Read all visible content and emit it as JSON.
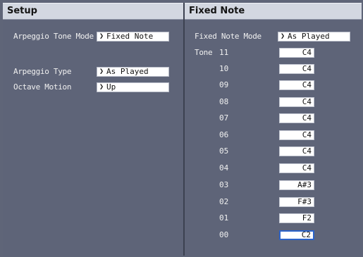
{
  "setup": {
    "title": "Setup",
    "arp_tone_mode_label": "Arpeggio Tone Mode",
    "arp_tone_mode_value": "Fixed Note",
    "arp_type_label": "Arpeggio Type",
    "arp_type_value": "As Played",
    "octave_motion_label": "Octave Motion",
    "octave_motion_value": "Up"
  },
  "fixed": {
    "title": "Fixed Note",
    "mode_label": "Fixed Note Mode",
    "mode_value": "As Played",
    "tone_label": "Tone",
    "tones": [
      {
        "num": "11",
        "note": "C4"
      },
      {
        "num": "10",
        "note": "C4"
      },
      {
        "num": "09",
        "note": "C4"
      },
      {
        "num": "08",
        "note": "C4"
      },
      {
        "num": "07",
        "note": "C4"
      },
      {
        "num": "06",
        "note": "C4"
      },
      {
        "num": "05",
        "note": "C4"
      },
      {
        "num": "04",
        "note": "C4"
      },
      {
        "num": "03",
        "note": "A#3"
      },
      {
        "num": "02",
        "note": "F#3"
      },
      {
        "num": "01",
        "note": "F2"
      },
      {
        "num": "00",
        "note": "C2"
      }
    ]
  },
  "arrow_glyph": "❯"
}
